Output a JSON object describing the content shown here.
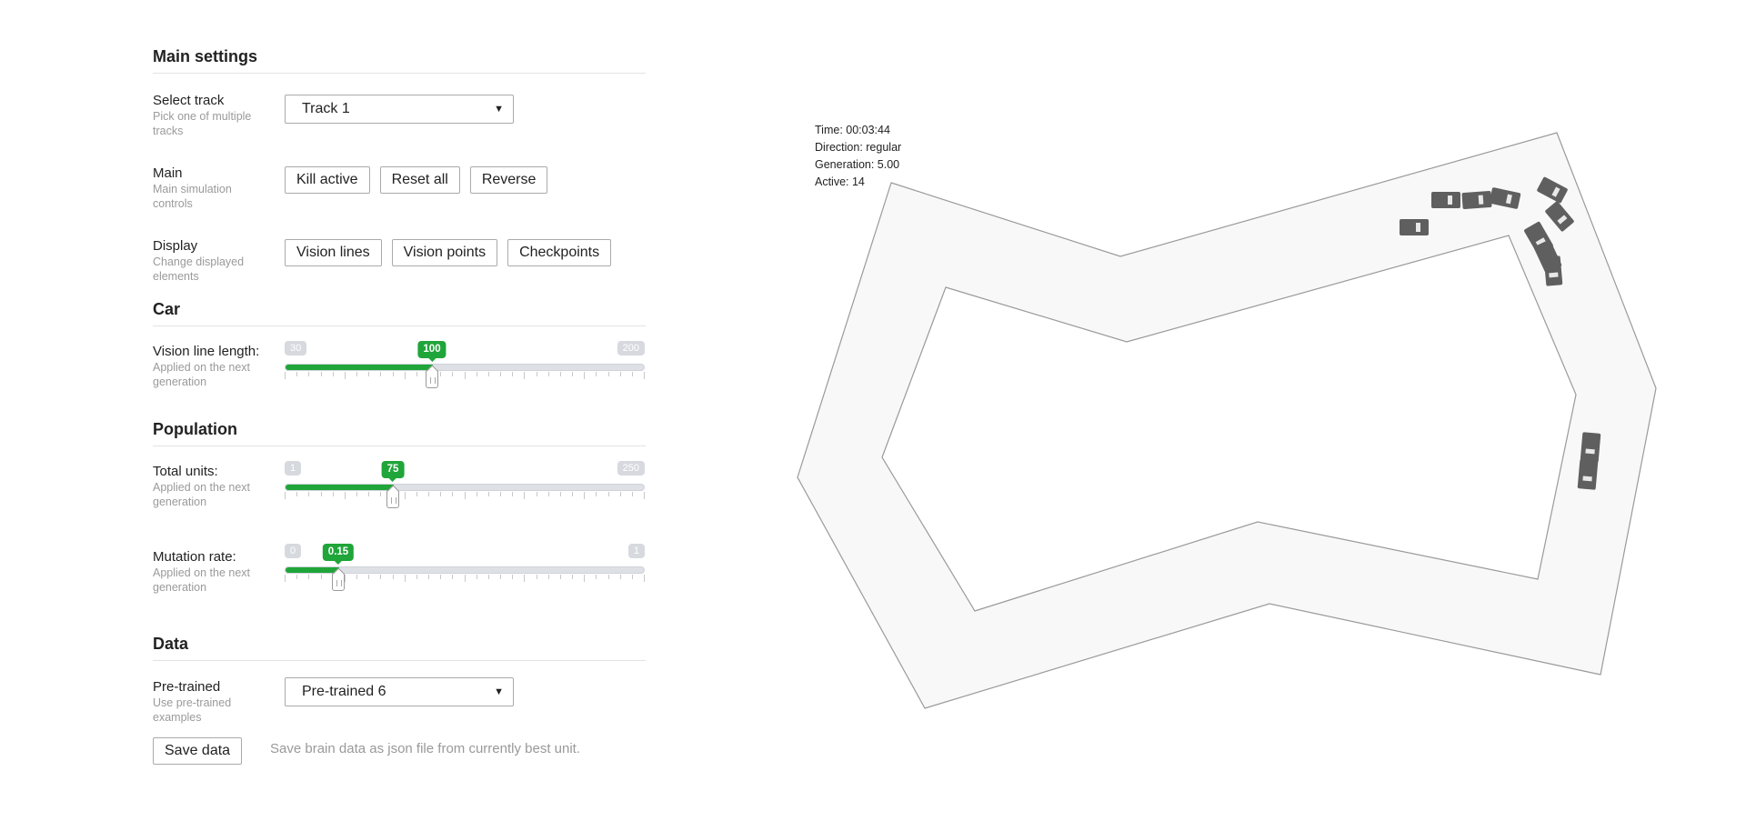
{
  "main_settings": {
    "title": "Main settings",
    "track": {
      "label": "Select track",
      "sub": "Pick one of multiple tracks",
      "value": "Track 1"
    },
    "main": {
      "label": "Main",
      "sub": "Main simulation controls",
      "buttons": [
        "Kill active",
        "Reset all",
        "Reverse"
      ]
    },
    "display": {
      "label": "Display",
      "sub": "Change displayed elements",
      "buttons": [
        "Vision lines",
        "Vision points",
        "Checkpoints"
      ]
    }
  },
  "car": {
    "title": "Car",
    "vision_length": {
      "label": "Vision line length:",
      "sub": "Applied on the next generation",
      "min": "30",
      "max": "200",
      "value": "100",
      "fraction": 0.41
    }
  },
  "population": {
    "title": "Population",
    "total_units": {
      "label": "Total units:",
      "sub": "Applied on the next generation",
      "min": "1",
      "max": "250",
      "value": "75",
      "fraction": 0.3
    },
    "mutation_rate": {
      "label": "Mutation rate:",
      "sub": "Applied on the next generation",
      "min": "0",
      "max": "1",
      "value": "0.15",
      "fraction": 0.15
    }
  },
  "data": {
    "title": "Data",
    "pretrained": {
      "label": "Pre-trained",
      "sub": "Use pre-trained examples",
      "value": "Pre-trained 6"
    },
    "save_label": "Save data",
    "save_desc": "Save brain data as json file from currently best unit."
  },
  "hud": {
    "time": "Time: 00:03:44",
    "direction": "Direction: regular",
    "generation": "Generation: 5.00",
    "active": "Active: 14"
  },
  "colors": {
    "accent": "#1fa539",
    "track_fill": "#f8f8f8",
    "track_edge": "#9a9a9a",
    "car": "#5f5f5f"
  }
}
